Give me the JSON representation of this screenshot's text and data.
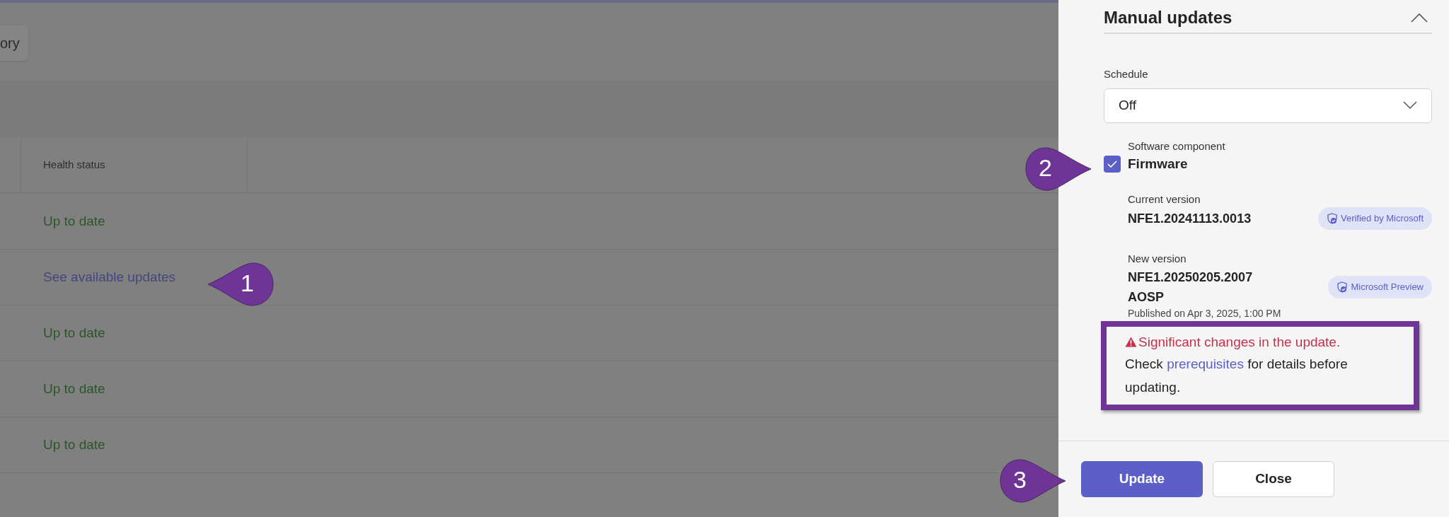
{
  "toolbar": {
    "button_label": "ory"
  },
  "table": {
    "columns": [
      "Health status"
    ],
    "rows": [
      {
        "health_status": "Up to date",
        "kind": "status"
      },
      {
        "health_status": "See available updates",
        "kind": "link"
      },
      {
        "health_status": "Up to date",
        "kind": "status"
      },
      {
        "health_status": "Up to date",
        "kind": "status"
      },
      {
        "health_status": "Up to date",
        "kind": "status"
      }
    ]
  },
  "panel": {
    "title": "Manual updates",
    "expanded": true,
    "schedule": {
      "label": "Schedule",
      "value": "Off"
    },
    "component": {
      "caption": "Software component",
      "name": "Firmware",
      "checked": true
    },
    "current_version": {
      "label": "Current version",
      "value": "NFE1.20241113.0013",
      "badge": "Verified by Microsoft"
    },
    "new_version": {
      "label": "New version",
      "value_lines": [
        "NFE1.20250205.2007",
        "AOSP"
      ],
      "badge": "Microsoft Preview",
      "published": "Published on Apr 3, 2025, 1:00 PM"
    },
    "warning": {
      "title": "Significant changes in the update.",
      "before": "Check",
      "link": "prerequisites",
      "after": "for details before updating."
    },
    "buttons": [
      {
        "label": "Update",
        "kind": "primary"
      },
      {
        "label": "Close",
        "kind": "secondary"
      }
    ]
  },
  "callouts": [
    {
      "label": "1",
      "kind": "points-left"
    },
    {
      "label": "2",
      "kind": "points-right"
    },
    {
      "label": "3",
      "kind": "points-right"
    }
  ]
}
